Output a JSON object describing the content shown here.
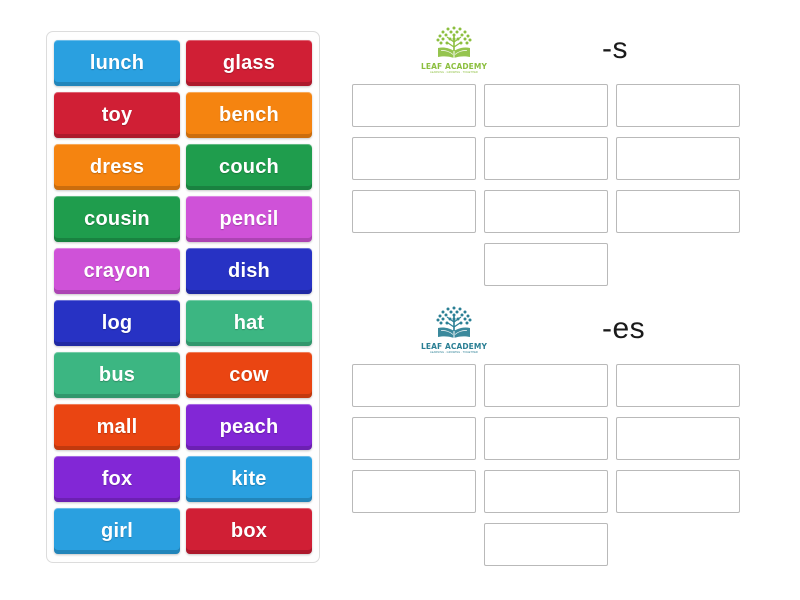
{
  "activity": {
    "type": "word-sort-drag-and-drop",
    "tray": {
      "columns": [
        {
          "tiles": [
            {
              "label": "lunch",
              "color": "#2aa0e0"
            },
            {
              "label": "toy",
              "color": "#d01f35"
            },
            {
              "label": "dress",
              "color": "#f58410"
            },
            {
              "label": "cousin",
              "color": "#1f9d4d"
            },
            {
              "label": "crayon",
              "color": "#cf52d8"
            },
            {
              "label": "log",
              "color": "#2732c4"
            },
            {
              "label": "bus",
              "color": "#3cb682"
            },
            {
              "label": "mall",
              "color": "#ea4512"
            },
            {
              "label": "fox",
              "color": "#8227d6"
            },
            {
              "label": "girl",
              "color": "#2aa0e0"
            }
          ]
        },
        {
          "tiles": [
            {
              "label": "glass",
              "color": "#d01f35"
            },
            {
              "label": "bench",
              "color": "#f58410"
            },
            {
              "label": "couch",
              "color": "#1f9d4d"
            },
            {
              "label": "pencil",
              "color": "#cf52d8"
            },
            {
              "label": "dish",
              "color": "#2732c4"
            },
            {
              "label": "hat",
              "color": "#3cb682"
            },
            {
              "label": "cow",
              "color": "#ea4512"
            },
            {
              "label": "peach",
              "color": "#8227d6"
            },
            {
              "label": "kite",
              "color": "#2aa0e0"
            },
            {
              "label": "box",
              "color": "#d01f35"
            }
          ]
        }
      ]
    },
    "groups": [
      {
        "title": "-s",
        "logo": {
          "name": "LEAF ACADEMY",
          "tagline": "LEARNING . GROWING . TOGETHER",
          "color": "#8cbf3f"
        },
        "slot_count": 10,
        "slots": [
          "",
          "",
          "",
          "",
          "",
          "",
          "",
          "",
          "",
          ""
        ]
      },
      {
        "title": "-es",
        "logo": {
          "name": "LEAF ACADEMY",
          "tagline": "LEARNING . GROWING . TOGETHER",
          "color": "#2a7f94"
        },
        "slot_count": 10,
        "slots": [
          "",
          "",
          "",
          "",
          "",
          "",
          "",
          "",
          "",
          ""
        ]
      }
    ]
  }
}
